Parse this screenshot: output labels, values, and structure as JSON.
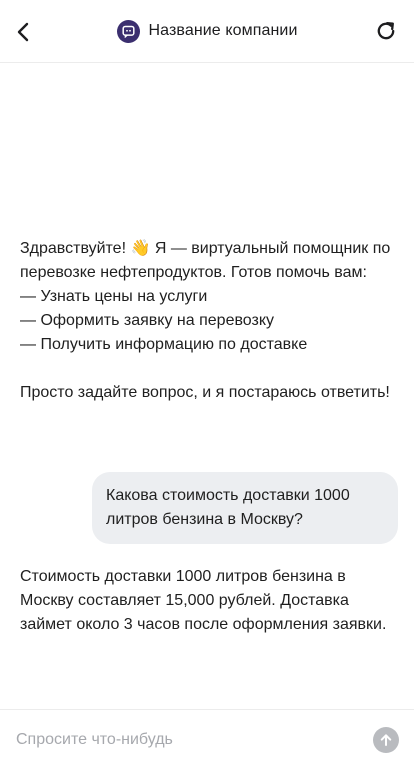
{
  "header": {
    "back_icon": "chevron-left-icon",
    "logo_icon": "chat-bubble-icon",
    "title": "Название компании",
    "refresh_icon": "refresh-icon",
    "logo_color": "#3b2f6f"
  },
  "messages": [
    {
      "role": "bot",
      "text": "Здравствуйте! 👋 Я — виртуальный помощник по перевозке нефтепродуктов. Готов помочь вам:\n— Узнать цены на услуги\n— Оформить заявку на перевозку\n— Получить информацию по доставке\n\nПросто задайте вопрос, и я постараюсь ответить!"
    },
    {
      "role": "user",
      "text": "Какова стоимость доставки 1000 литров бензина в Москву?"
    },
    {
      "role": "bot",
      "text": "Стоимость доставки 1000 литров бензина в Москву составляет 15,000 рублей. Доставка займет около 3 часов после оформления заявки."
    }
  ],
  "input": {
    "placeholder": "Спросите что-нибудь",
    "value": "",
    "send_icon": "arrow-up-icon"
  },
  "colors": {
    "user_bubble": "#eceef1",
    "send_button": "#b9bbbf",
    "placeholder": "#a6a8ad"
  }
}
